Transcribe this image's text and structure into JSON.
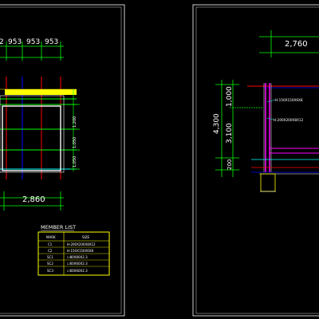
{
  "left_sheet": {
    "top_dims": [
      "953",
      "953",
      "953"
    ],
    "top_dim_partial": "2",
    "side_dims": [
      "1,200",
      "1,050",
      "1,050"
    ],
    "bottom_dim": "2,860"
  },
  "member_list": {
    "title": "MEMBER  LIST",
    "headers": [
      "MARK",
      "SIZE"
    ],
    "rows": [
      {
        "mark": "C1",
        "size": "H-200X200X8X12"
      },
      {
        "mark": "C2",
        "size": "H-150X150X6X8"
      },
      {
        "mark": "SC1",
        "size": "☐80X80X2.3"
      },
      {
        "mark": "SC2",
        "size": "☐60X60X2.3"
      },
      {
        "mark": "SC3",
        "size": "☐60X60X2.3"
      }
    ]
  },
  "right_sheet": {
    "top_dim": "2,760",
    "overall_dim": "4,300",
    "vertical_dims": [
      "1,000",
      "3,100",
      "200"
    ],
    "callouts": [
      "H-150X150X6X8",
      "H-200X200X8X12"
    ]
  },
  "colors": {
    "background": "#000000",
    "frame": "#ffffff",
    "dimension": "#00ff00",
    "member": "#ffff00",
    "column": "#ff0000",
    "beam": "#0000ff",
    "cyan": "#00ffff",
    "magenta": "#ff00ff"
  }
}
